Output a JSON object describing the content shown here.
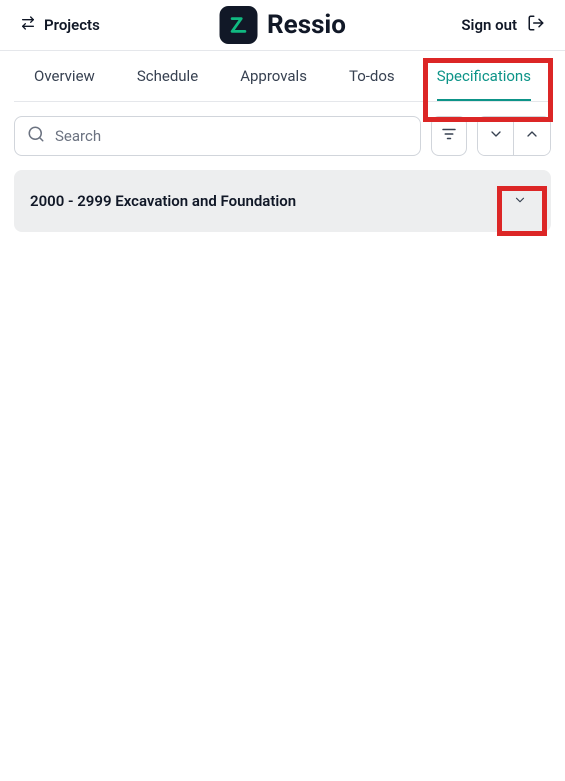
{
  "header": {
    "projects_label": "Projects",
    "brand": "Ressio",
    "signout_label": "Sign out"
  },
  "tabs": {
    "overview": "Overview",
    "schedule": "Schedule",
    "approvals": "Approvals",
    "todos": "To-dos",
    "specifications": "Specifications"
  },
  "search": {
    "placeholder": "Search"
  },
  "section": {
    "title": "2000 - 2999 Excavation and Foundation"
  }
}
